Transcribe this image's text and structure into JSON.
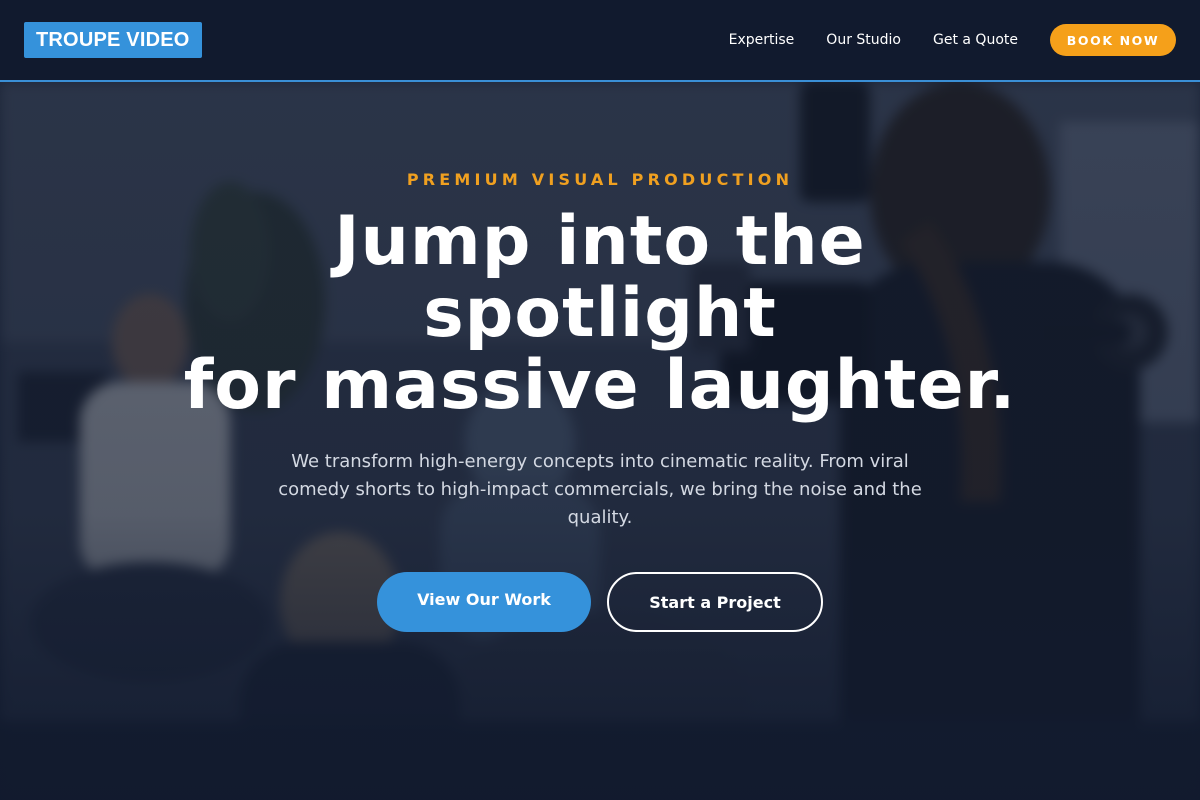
{
  "header": {
    "logo": "TROUPE VIDEO",
    "nav": [
      {
        "label": "Expertise"
      },
      {
        "label": "Our Studio"
      },
      {
        "label": "Get a Quote"
      }
    ],
    "cta": "BOOK NOW"
  },
  "hero": {
    "eyebrow": "PREMIUM VISUAL PRODUCTION",
    "headline": [
      "Jump into the",
      "spotlight",
      "for massive laughter."
    ],
    "subtext": "We transform high-energy concepts into cinematic reality. From viral comedy shorts to high-impact commercials, we bring the noise and the quality.",
    "primary_button": "View Our Work",
    "secondary_button": "Start a Project"
  },
  "colors": {
    "background": "#111a2e",
    "brand_blue": "#3592db",
    "accent_orange": "#f5a01a",
    "text_muted": "#d3d8e2"
  }
}
